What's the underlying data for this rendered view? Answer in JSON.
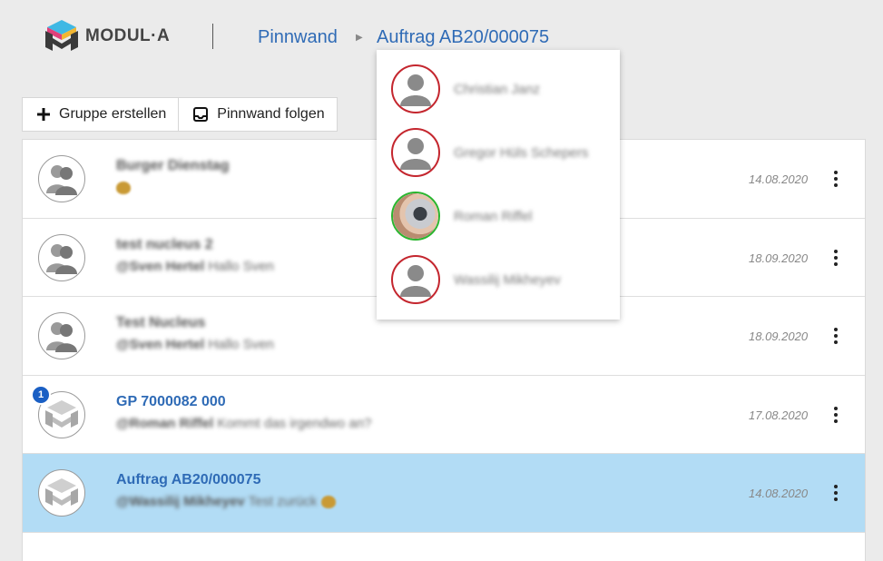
{
  "brand": {
    "logo_text": "MODUL·A",
    "colors": [
      "#3fb8e4",
      "#e0407a",
      "#f2b632",
      "#3a3a3a"
    ]
  },
  "breadcrumb": {
    "root": "Pinnwand",
    "current": "Auftrag AB20/000075"
  },
  "toolbar": {
    "create_group": "Gruppe erstellen",
    "follow_board": "Pinnwand folgen"
  },
  "threads": [
    {
      "title": "Burger Dienstag",
      "mention": "",
      "message": "",
      "date": "14.08.2020",
      "avatar": "people-group-icon",
      "unread": null,
      "active": false
    },
    {
      "title": "test nucleus 2",
      "mention": "@Sven Hertel",
      "message": "Hallo Sven",
      "date": "18.09.2020",
      "avatar": "people-group-icon",
      "unread": null,
      "active": false
    },
    {
      "title": "Test Nucleus",
      "mention": "@Sven Hertel",
      "message": "Hallo Sven",
      "date": "18.09.2020",
      "avatar": "people-group-icon",
      "unread": null,
      "active": false
    },
    {
      "title": "GP 7000082 000",
      "mention": "@Roman Riffel",
      "message": "Kommt das irgendwo an?",
      "date": "17.08.2020",
      "avatar": "modula-logo-icon",
      "unread": "1",
      "active": false
    },
    {
      "title": "Auftrag AB20/000075",
      "mention": "@Wassilij Mikheyev",
      "message": "Test zurück",
      "date": "14.08.2020",
      "avatar": "modula-logo-icon",
      "unread": null,
      "active": true
    }
  ],
  "members": [
    {
      "name": "Christian Janz",
      "status": "offline",
      "status_color": "#c4262e"
    },
    {
      "name": "Gregor Hüls Schepers",
      "status": "offline",
      "status_color": "#c4262e"
    },
    {
      "name": "Roman Riffel",
      "status": "online",
      "status_color": "#2ab52f"
    },
    {
      "name": "Wassilij Mikheyev",
      "status": "offline",
      "status_color": "#c4262e"
    }
  ],
  "accent": "#2f6bb6",
  "active_row_color": "#b2dcf5",
  "badge_color": "#1a5fc4"
}
